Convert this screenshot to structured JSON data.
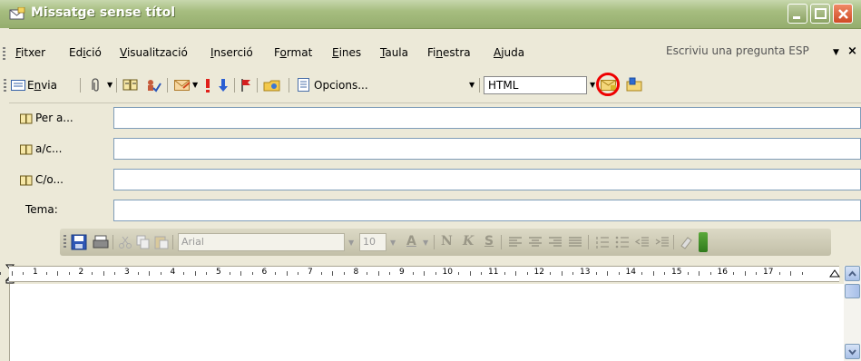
{
  "window": {
    "title": "Missatge sense títol"
  },
  "menu": {
    "items": [
      {
        "label": "Fitxer",
        "accel": "F",
        "rest": "itxer"
      },
      {
        "label": "Edició",
        "pre": "Ed",
        "accel": "i",
        "rest": "ció"
      },
      {
        "label": "Visualització",
        "accel": "V",
        "rest": "isualització"
      },
      {
        "label": "Inserció",
        "accel": "I",
        "rest": "nserció"
      },
      {
        "label": "Format",
        "pre": "F",
        "accel": "o",
        "rest": "rmat"
      },
      {
        "label": "Eines",
        "accel": "E",
        "rest": "ines"
      },
      {
        "label": "Taula",
        "accel": "T",
        "rest": "aula"
      },
      {
        "label": "Finestra",
        "pre": "Fi",
        "accel": "n",
        "rest": "estra"
      },
      {
        "label": "Ajuda",
        "accel": "A",
        "rest": "juda"
      }
    ],
    "help_placeholder": "Escriviu una pregunta ESP",
    "help_arrow": "▼",
    "help_close": "×"
  },
  "toolbar": {
    "send_pre": "E",
    "send_accel": "n",
    "send_rest": "via",
    "options_label": "Opcions...",
    "format_value": "HTML",
    "dropdown_arrow": "▼"
  },
  "header": {
    "to_label": "Per a...",
    "cc_label": "a/c...",
    "bcc_label": "C/o...",
    "subject_label": "Tema:",
    "to_value": "",
    "cc_value": "",
    "bcc_value": "",
    "subject_value": ""
  },
  "format_bar": {
    "font": "Arial",
    "size": "10",
    "font_color_letter": "A",
    "bold": "N",
    "italic": "K",
    "underline": "S"
  },
  "ruler": {
    "numbers": [
      "1",
      "2",
      "3",
      "4",
      "5",
      "6",
      "7",
      "8",
      "9",
      "10",
      "11",
      "12",
      "13",
      "14",
      "15",
      "16",
      "17"
    ]
  },
  "colors": {
    "title_bar": "#a6bd7f",
    "chrome": "#ece9d8",
    "highlight_circle": "#ee0000"
  }
}
